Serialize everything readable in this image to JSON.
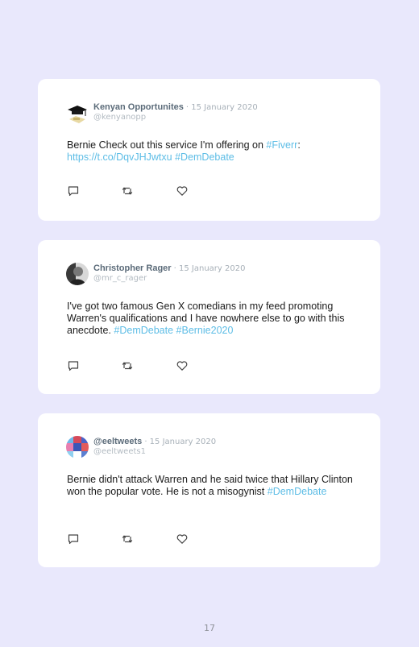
{
  "tweets": [
    {
      "name": "Kenyan Opportunites",
      "date": "· 15 January 2020",
      "handle": "@kenyanopp",
      "text": [
        "Bernie Check out this service I'm offering on ",
        "#Fiverr",
        ": ",
        "https://t.co/DqvJHJwtxu",
        " ",
        "#DemDebate",
        "",
        "",
        "",
        "",
        ""
      ]
    },
    {
      "name": "Christopher Rager",
      "date": "· 15 January 2020",
      "handle": "@mr_c_rager",
      "text": [
        "I've got two famous Gen X comedians in my feed promoting Warren's qualifications and I have nowhere else to go with this anecdote. ",
        "#DemDebate",
        " ",
        "#Bernie2020",
        "",
        "",
        "",
        "",
        "",
        "",
        ""
      ]
    },
    {
      "name": "@eeltweets",
      "date": "· 15 January 2020",
      "handle": "@eeltweets1",
      "text": [
        "Bernie didn't attack Warren and he said twice that Hillary Clinton won the popular vote. He is not a misogynist ",
        "#DemDebate",
        "",
        "",
        "",
        "",
        "",
        "",
        "",
        "",
        ""
      ]
    }
  ],
  "icons": [
    "reply-icon",
    "retweet-icon",
    "like-icon"
  ],
  "colors": {
    "background": "#e9e8fc",
    "card": "#ffffff",
    "link": "#5dbde6",
    "name": "#5b6b79",
    "meta": "#a7b0b8"
  },
  "page_number": "17"
}
